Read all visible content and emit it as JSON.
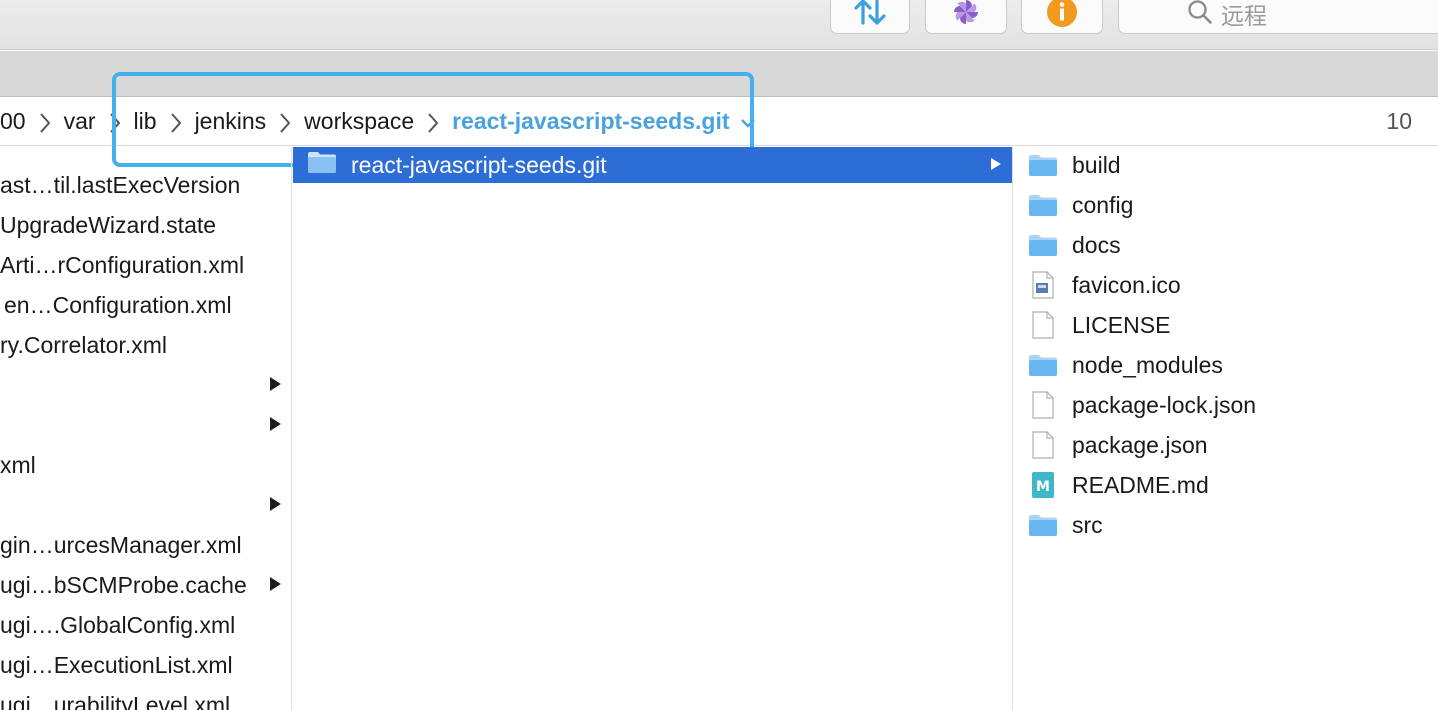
{
  "toolbar": {
    "search_placeholder": "远程",
    "buttons": [
      {
        "name": "sync-button",
        "icon": "up-down-arrows-icon"
      },
      {
        "name": "pinwheel-button",
        "icon": "pinwheel-icon"
      },
      {
        "name": "info-button",
        "icon": "info-icon"
      }
    ],
    "colors": {
      "accent_blue": "#3aa0dd",
      "purple": "#8a5ec9",
      "orange": "#f29a1d"
    }
  },
  "path": {
    "crumbs": [
      "00",
      "var",
      "lib",
      "jenkins",
      "workspace",
      "react-javascript-seeds.git"
    ],
    "count": "10"
  },
  "column1": {
    "items": [
      {
        "label": "ast…til.lastExecVersion",
        "arrow": false
      },
      {
        "label": "UpgradeWizard.state",
        "arrow": false
      },
      {
        "label": "Arti…rConfiguration.xml",
        "arrow": false
      },
      {
        "label": "en…Configuration.xml",
        "arrow": false
      },
      {
        "label": "ry.Correlator.xml",
        "arrow": false
      },
      {
        "label": "",
        "arrow": true
      },
      {
        "label": "",
        "arrow": true
      },
      {
        "label": "xml",
        "arrow": false
      },
      {
        "label": "",
        "arrow": true
      },
      {
        "label": "gin…urcesManager.xml",
        "arrow": false
      },
      {
        "label": "ugi…bSCMProbe.cache",
        "arrow": true
      },
      {
        "label": "ugi….GlobalConfig.xml",
        "arrow": false
      },
      {
        "label": "ugi…ExecutionList.xml",
        "arrow": false
      },
      {
        "label": "ugi…urabilityLevel.xml",
        "arrow": false
      }
    ]
  },
  "column2": {
    "selected": "react-javascript-seeds.git"
  },
  "column3": {
    "items": [
      {
        "label": "build",
        "icon": "folder-icon"
      },
      {
        "label": "config",
        "icon": "folder-icon"
      },
      {
        "label": "docs",
        "icon": "folder-icon"
      },
      {
        "label": "favicon.ico",
        "icon": "image-file-icon"
      },
      {
        "label": "LICENSE",
        "icon": "document-icon"
      },
      {
        "label": "node_modules",
        "icon": "folder-icon"
      },
      {
        "label": "package-lock.json",
        "icon": "document-icon"
      },
      {
        "label": "package.json",
        "icon": "document-icon"
      },
      {
        "label": "README.md",
        "icon": "markdown-file-icon"
      },
      {
        "label": "src",
        "icon": "folder-icon"
      }
    ]
  }
}
